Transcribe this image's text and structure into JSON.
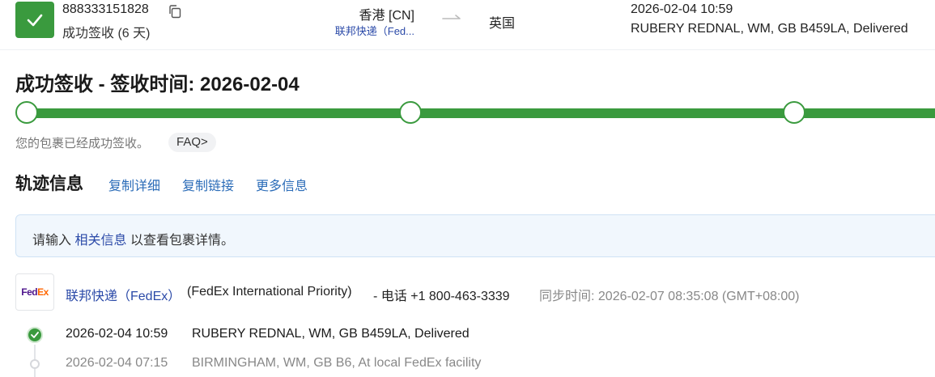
{
  "header": {
    "tracking_number": "888333151828",
    "status": "成功签收 (6 天)",
    "origin": "香港 [CN]",
    "carrier_short": "联邦快递（Fed...",
    "destination": "英国",
    "latest_time": "2026-02-04 10:59",
    "latest_event": "RUBERY REDNAL, WM, GB B459LA, Delivered"
  },
  "status_block": {
    "title": "成功签收 - 签收时间: 2026-02-04",
    "progress_percent": 100,
    "message": "您的包裹已经成功签收。",
    "faq_label": "FAQ>"
  },
  "tracking_section": {
    "title": "轨迹信息",
    "links": [
      "复制详细",
      "复制链接",
      "更多信息"
    ]
  },
  "banner": {
    "prefix": "请输入",
    "link": "相关信息",
    "suffix": "以查看包裹详情。"
  },
  "carrier": {
    "logo_fed": "Fed",
    "logo_ex": "Ex",
    "name": "联邦快递（FedEx）",
    "service": "(FedEx International Priority)",
    "phone": "- 电话 +1 800-463-3339",
    "sync_time": "同步时间: 2026-02-07 08:35:08 (GMT+08:00)"
  },
  "events": [
    {
      "time": "2026-02-04 10:59",
      "desc": "RUBERY REDNAL, WM, GB B459LA, Delivered"
    },
    {
      "time": "2026-02-04 07:15",
      "desc": "BIRMINGHAM, WM, GB B6, At local FedEx facility"
    }
  ],
  "colors": {
    "accent_green": "#3a9a3e",
    "link_blue": "#2b6cb8",
    "carrier_blue": "#2b4aa8"
  }
}
